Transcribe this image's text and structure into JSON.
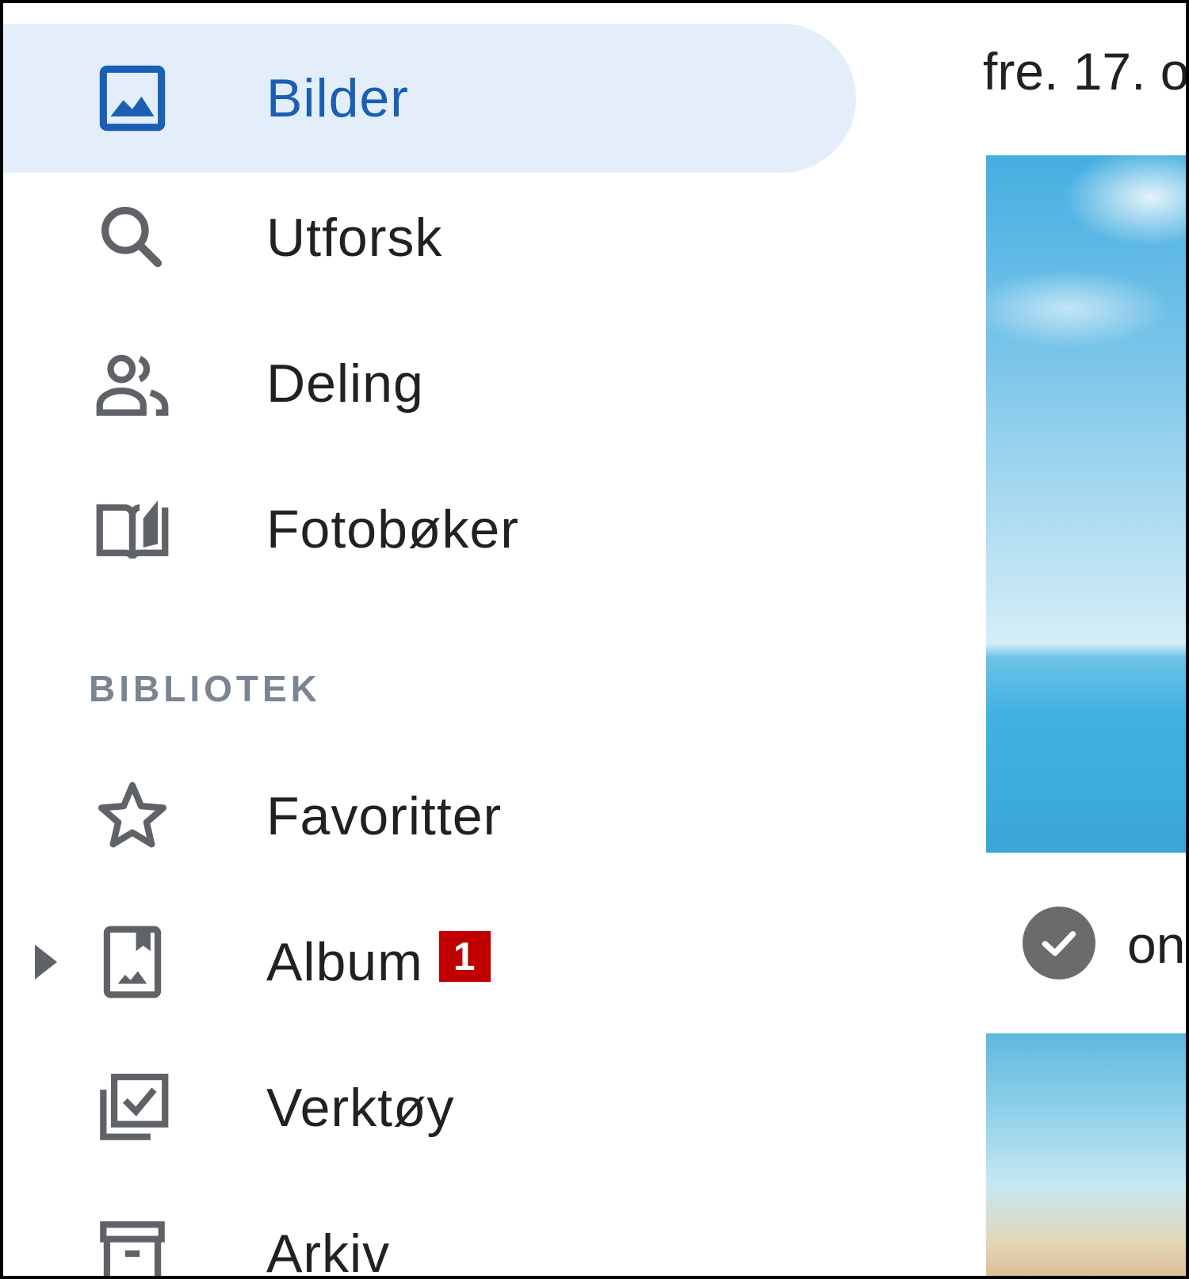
{
  "sidebar": {
    "items": [
      {
        "label": "Bilder",
        "icon": "photo-icon",
        "active": true
      },
      {
        "label": "Utforsk",
        "icon": "search-icon"
      },
      {
        "label": "Deling",
        "icon": "people-icon"
      },
      {
        "label": "Fotobøker",
        "icon": "photobook-icon"
      }
    ],
    "library_title": "BIBLIOTEK",
    "library_items": [
      {
        "label": "Favoritter",
        "icon": "star-icon"
      },
      {
        "label": "Album",
        "icon": "album-icon",
        "badge": "1"
      },
      {
        "label": "Verktøy",
        "icon": "tools-icon"
      },
      {
        "label": "Arkiv",
        "icon": "archive-icon"
      }
    ]
  },
  "main": {
    "date_heading": "fre. 17. o",
    "photo_label": "on"
  },
  "colors": {
    "active_bg": "#e3eefa",
    "active_text": "#1a5fb4",
    "section_title": "#7a8593",
    "badge": "#c00000"
  }
}
